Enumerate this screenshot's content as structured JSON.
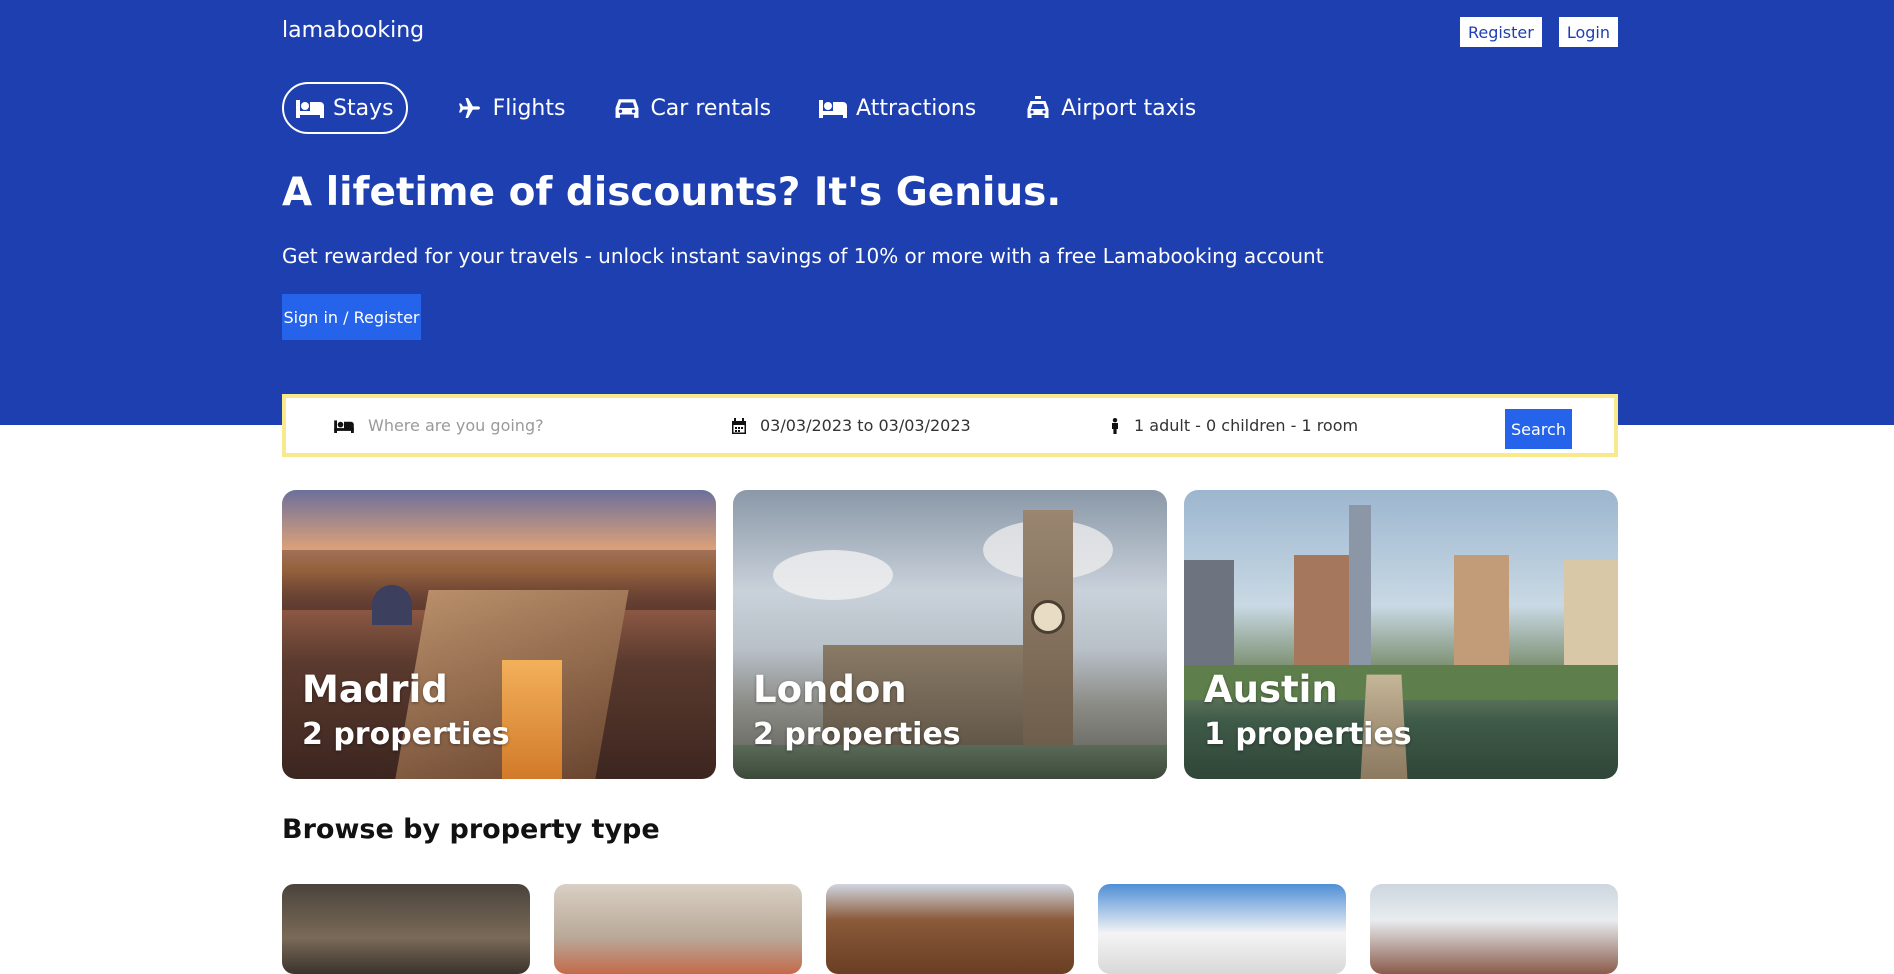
{
  "header": {
    "logo": "lamabooking",
    "register_label": "Register",
    "login_label": "Login"
  },
  "nav": {
    "items": [
      {
        "label": "Stays",
        "icon": "bed-icon",
        "active": true
      },
      {
        "label": "Flights",
        "icon": "plane-icon",
        "active": false
      },
      {
        "label": "Car rentals",
        "icon": "car-icon",
        "active": false
      },
      {
        "label": "Attractions",
        "icon": "bed-icon",
        "active": false
      },
      {
        "label": "Airport taxis",
        "icon": "taxi-icon",
        "active": false
      }
    ]
  },
  "hero": {
    "title": "A lifetime of discounts? It's Genius.",
    "subtitle": "Get rewarded for your travels - unlock instant savings of 10% or more with a free Lamabooking account",
    "signin_label": "Sign in / Register"
  },
  "search": {
    "destination_placeholder": "Where are you going?",
    "dates": "03/03/2023 to 03/03/2023",
    "guests": "1 adult - 0 children - 1 room",
    "search_label": "Search"
  },
  "featured": [
    {
      "city": "Madrid",
      "properties": "2 properties"
    },
    {
      "city": "London",
      "properties": "2 properties"
    },
    {
      "city": "Austin",
      "properties": "1 properties"
    }
  ],
  "property_types": {
    "title": "Browse by property type"
  },
  "colors": {
    "brand_blue": "#1e3fb0",
    "button_blue": "#2563eb",
    "search_border": "#f9e98d"
  }
}
